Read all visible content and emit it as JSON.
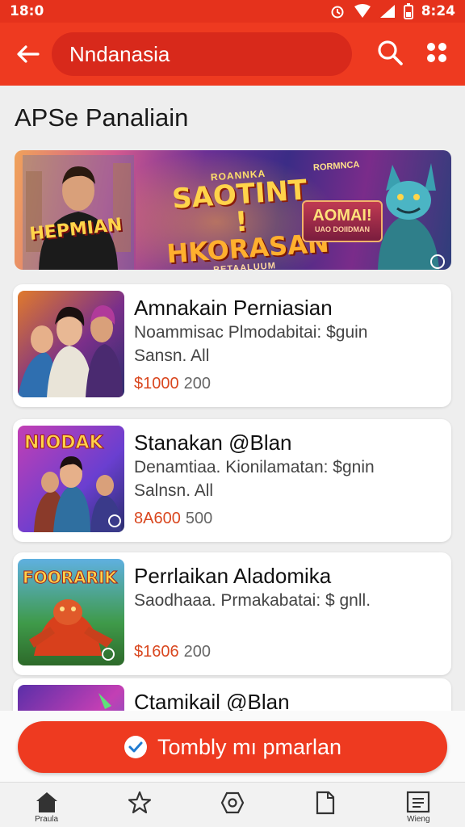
{
  "status_bar": {
    "time": "18:0",
    "clock_right": "8:24"
  },
  "app_bar": {
    "search_text": "Nndanasia",
    "icons": [
      "back-arrow-icon",
      "search-icon",
      "apps-icon"
    ]
  },
  "section_title": "APSe Panaliain",
  "banner": {
    "person_tag": "HEPMIAN",
    "top_tag": "RORMNCA",
    "headline_small": "ROANNKA",
    "headline_line1": "SAOTINT !",
    "headline_line2": "HKORASAN",
    "headline_sub": "BETAALUUM",
    "promo_title": "AOMAI!",
    "promo_sub": "UAO DOIIDMAN"
  },
  "games": [
    {
      "title": "Amnakain Perniasian",
      "subtitle": "Noammisac Plmodabitai: $guin",
      "meta": "Sansn. All",
      "price": "$1000",
      "count": "200",
      "thumb_colors": [
        "#e07a2c",
        "#7a2f8a",
        "#2a2e6e"
      ]
    },
    {
      "title": "Stanakan @Blan",
      "subtitle": "Denamtiaa. Kionilamatan: $gnin",
      "meta": "Salnsn. All",
      "price": "8A600",
      "count": "500",
      "thumb_colors": [
        "#c33fb4",
        "#6a3fd0",
        "#f0a030"
      ]
    },
    {
      "title": "Perrlaikan Aladomika",
      "subtitle": "Saodhaaa. Prmakabatai: $ gnll.",
      "meta": "",
      "price": "$1606",
      "count": "200",
      "thumb_colors": [
        "#2d8a3a",
        "#5fb0e0",
        "#d8401c"
      ]
    },
    {
      "title": "Ctamikail @Blan",
      "subtitle": "",
      "meta": "",
      "price": "",
      "count": "",
      "thumb_colors": [
        "#5a2fa8",
        "#c33fb4",
        "#3a6ad0"
      ]
    }
  ],
  "cta": {
    "label": "Tombly mı pmarlan"
  },
  "bottom_nav": {
    "items": [
      {
        "icon": "home-icon",
        "label": "Praula"
      },
      {
        "icon": "star-icon",
        "label": ""
      },
      {
        "icon": "store-icon",
        "label": ""
      },
      {
        "icon": "document-icon",
        "label": ""
      },
      {
        "icon": "menu-list-icon",
        "label": "Wieng"
      }
    ]
  },
  "colors": {
    "primary": "#ee3a20",
    "status": "#e5321c",
    "price": "#d9471f"
  }
}
